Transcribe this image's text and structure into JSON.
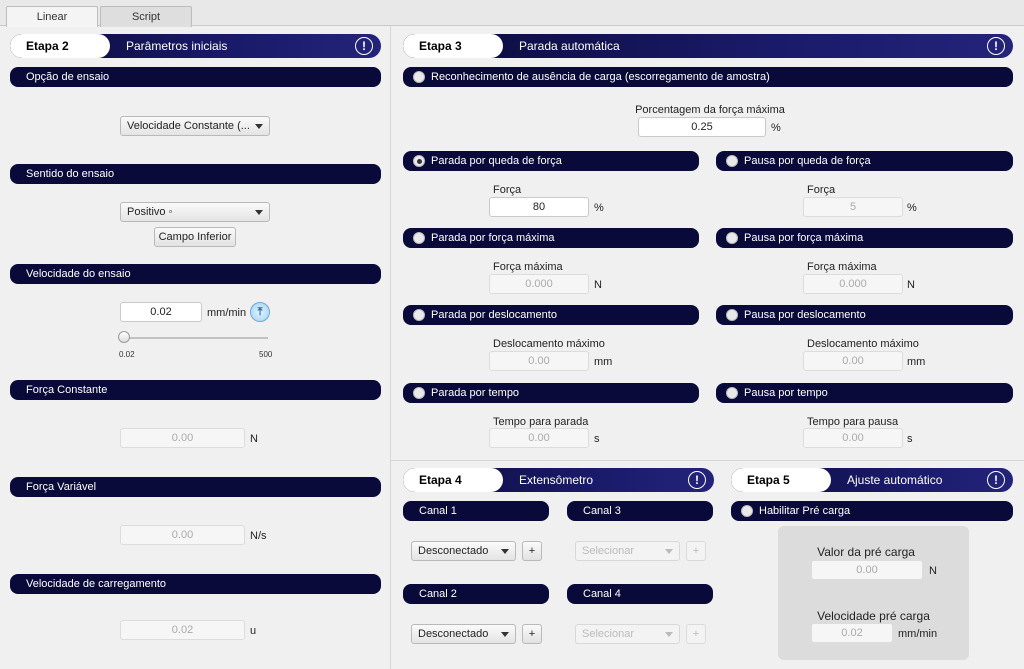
{
  "tabs": [
    "Linear",
    "Script"
  ],
  "etapa2": {
    "step": "Etapa 2",
    "title": "Parâmetros iniciais",
    "opcao": {
      "header": "Opção de ensaio",
      "value": "Velocidade Constante (..."
    },
    "sentido": {
      "header": "Sentido do ensaio",
      "value": "Positivo ◦",
      "button": "Campo Inferior"
    },
    "velocidade": {
      "header": "Velocidade do ensaio",
      "value": "0.02",
      "unit": "mm/min",
      "slider_min": "0.02",
      "slider_max": "500",
      "slider_level": 0
    },
    "forca_const": {
      "header": "Força Constante",
      "value": "0.00",
      "unit": "N"
    },
    "forca_var": {
      "header": "Força Variável",
      "value": "0.00",
      "unit": "N/s"
    },
    "vel_carreg": {
      "header": "Velocidade de carregamento",
      "value": "0.02",
      "unit": "u"
    }
  },
  "etapa3": {
    "step": "Etapa 3",
    "title": "Parada automática",
    "reconhecimento": "Reconhecimento de ausência de carga (escorregamento de amostra)",
    "porcentagem_label": "Porcentagem da força máxima",
    "porcentagem_value": "0.25",
    "porcentagem_unit": "%",
    "parada_queda": "Parada por queda de força",
    "pausa_queda": "Pausa por queda de força",
    "forca_label": "Força",
    "parada_queda_value": "80",
    "pausa_queda_value": "5",
    "pct": "%",
    "parada_max": "Parada por força máxima",
    "pausa_max": "Pausa por força máxima",
    "forca_max_label": "Força máxima",
    "parada_max_value": "0.000",
    "pausa_max_value": "0.000",
    "n": "N",
    "parada_desl": "Parada por deslocamento",
    "pausa_desl": "Pausa por deslocamento",
    "desl_label": "Deslocamento máximo",
    "parada_desl_value": "0.00",
    "pausa_desl_value": "0.00",
    "mm": "mm",
    "parada_tempo": "Parada por tempo",
    "pausa_tempo": "Pausa por tempo",
    "tempo_parada_label": "Tempo para parada",
    "tempo_pausa_label": "Tempo para pausa",
    "parada_tempo_value": "0.00",
    "pausa_tempo_value": "0.00",
    "s": "s"
  },
  "etapa4": {
    "step": "Etapa 4",
    "title": "Extensômetro",
    "canal1": "Canal 1",
    "canal2": "Canal 2",
    "canal3": "Canal 3",
    "canal4": "Canal 4",
    "desconectado": "Desconectado",
    "selecionar": "Selecionar",
    "plus": "+"
  },
  "etapa5": {
    "step": "Etapa 5",
    "title": "Ajuste automático",
    "habilitar": "Habilitar Pré carga",
    "valor_label": "Valor da pré carga",
    "valor_value": "0.00",
    "valor_unit": "N",
    "vel_label": "Velocidade pré carga",
    "vel_value": "0.02",
    "vel_unit": "mm/min"
  },
  "warn_icon": "!"
}
